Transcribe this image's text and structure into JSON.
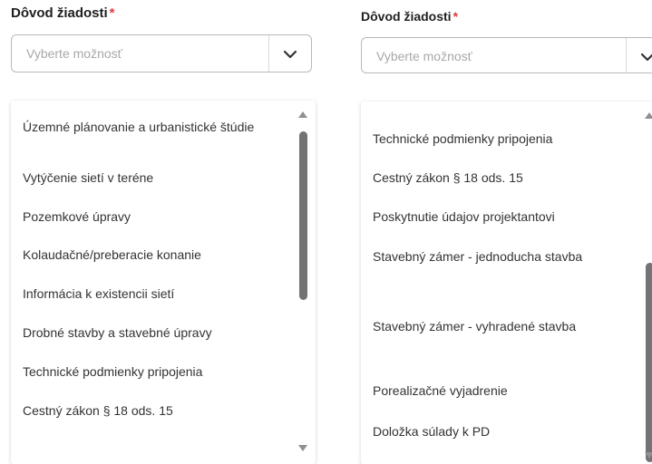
{
  "left": {
    "label": "Dôvod žiadosti",
    "required_mark": "*",
    "placeholder": "Vyberte možnosť",
    "options": [
      "Územné plánovanie a urbanistické štúdie",
      "Vytýčenie sietí v teréne",
      "Pozemkové úpravy",
      "Kolaudačné/preberacie konanie",
      "Informácia k existencii sietí",
      "Drobné stavby a stavebné úpravy",
      "Technické podmienky pripojenia",
      "Cestný zákon § 18 ods. 15"
    ]
  },
  "right": {
    "label": "Dôvod žiadosti",
    "required_mark": "*",
    "placeholder": "Vyberte možnosť",
    "options": [
      "Technické podmienky pripojenia",
      "Cestný zákon § 18 ods. 15",
      "Poskytnutie údajov projektantovi",
      "Stavebný zámer - jednoducha stavba",
      "Stavebný zámer - vyhradené stavba",
      "Porealizačné vyjadrenie",
      "Doložka súlady k PD"
    ]
  },
  "icons": {
    "select_chevron": "chevron-down-icon",
    "scroll_up": "scroll-up-arrow-icon",
    "scroll_down": "scroll-down-arrow-icon"
  },
  "colors": {
    "required": "#e03a3a",
    "placeholder": "#a8a8a8",
    "scroll_thumb": "#737373"
  }
}
